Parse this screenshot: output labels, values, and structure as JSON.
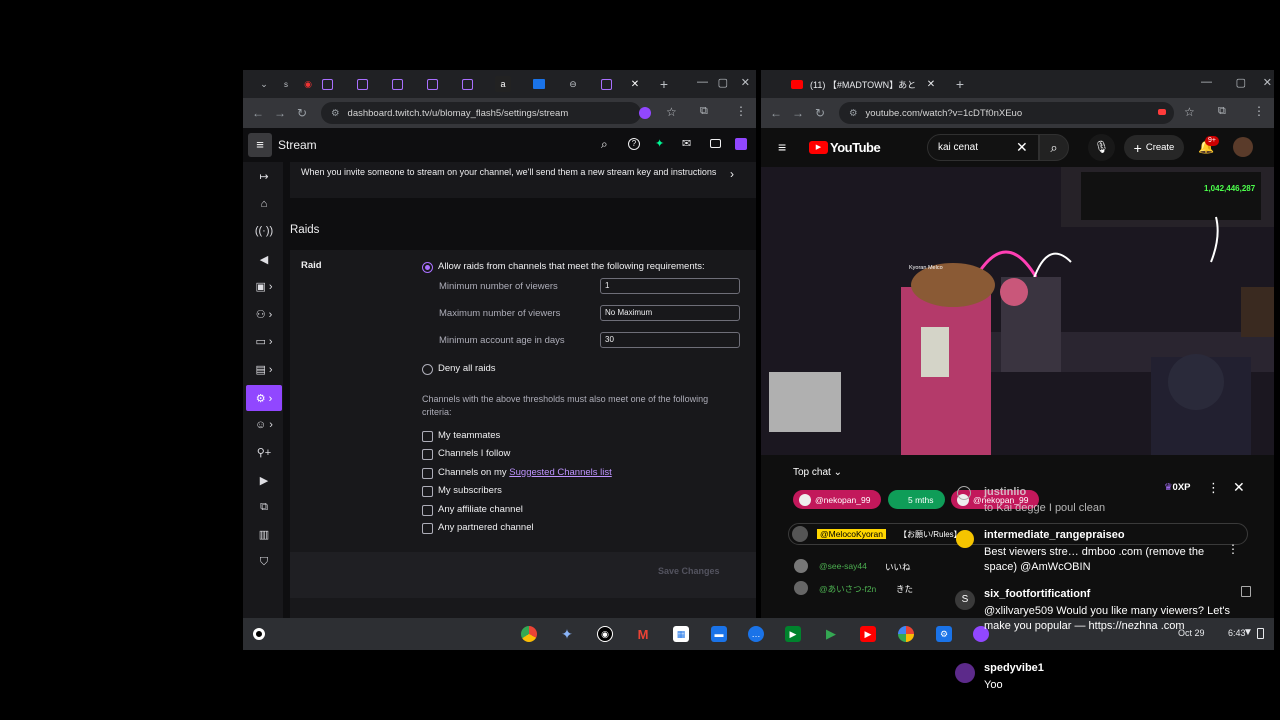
{
  "left_browser": {
    "tabs": [
      "s",
      "t",
      "l",
      "l",
      "\\",
      "l",
      "/",
      "l",
      "l"
    ],
    "url": "dashboard.twitch.tv/u/blomay_flash5/settings/stream"
  },
  "twitch": {
    "header_title": "Stream",
    "invite_text": "When you invite someone to stream on your channel, we'll send them a new stream key and instructions",
    "raids_heading": "Raids",
    "raid_label": "Raid",
    "allow_option": "Allow raids from channels that meet the following requirements:",
    "min_viewers_label": "Minimum number of viewers",
    "min_viewers_value": "1",
    "max_viewers_label": "Maximum number of viewers",
    "max_viewers_value": "No Maximum",
    "min_age_label": "Minimum account age in days",
    "min_age_value": "30",
    "deny_option": "Deny all raids",
    "thresholds_text": "Channels with the above thresholds must also meet one of the following criteria:",
    "criteria": [
      "My teammates",
      "Channels I follow",
      "Channels on my ",
      "My subscribers",
      "Any affiliate channel",
      "Any partnered channel"
    ],
    "suggested_link": "Suggested Channels list",
    "save_label": "Save Changes"
  },
  "right_browser": {
    "tab_title": "(11) 【#MADTOWN】あと",
    "url": "youtube.com/watch?v=1cDTf0nXEuo"
  },
  "youtube": {
    "logo": "YouTube",
    "search_value": "kai cenat",
    "create_label": "Create",
    "notif_badge": "9+",
    "video_counter": "1,042,446,287",
    "video_label": "Kyoran Melco",
    "chat_mode": "Top chat",
    "pills": [
      "@nekopan_99",
      "5 mths",
      "@nekopan_99"
    ],
    "pinned": "@MelocoKyoran",
    "pinned_suffix": "【お願い/Rules】",
    "chat_lines": [
      {
        "name": "@see-say44",
        "msg": "いいね"
      },
      {
        "name": "@あいさつ-f2n",
        "msg": "きた"
      }
    ]
  },
  "overlay_chat": {
    "xp": "0XP",
    "messages": [
      {
        "name": "justinlio",
        "msg": "to Kai degge I poul clean"
      },
      {
        "name": "intermediate_rangepraiseo",
        "msg": "Best viewers stre… dmboo .com (remove the space) @AmWcOBIN"
      },
      {
        "name": "six_footfortificationf",
        "msg": "@xlilvarye509 Would you like many viewers? Let's make you popular — https://nezhna .com"
      },
      {
        "name": "spedyvibe1",
        "msg": "Yoo"
      }
    ]
  },
  "taskbar": {
    "date": "Oct 29",
    "time": "6:43"
  },
  "colors": {
    "twitch_purple": "#9147ff",
    "yt_red": "#ff0000"
  }
}
